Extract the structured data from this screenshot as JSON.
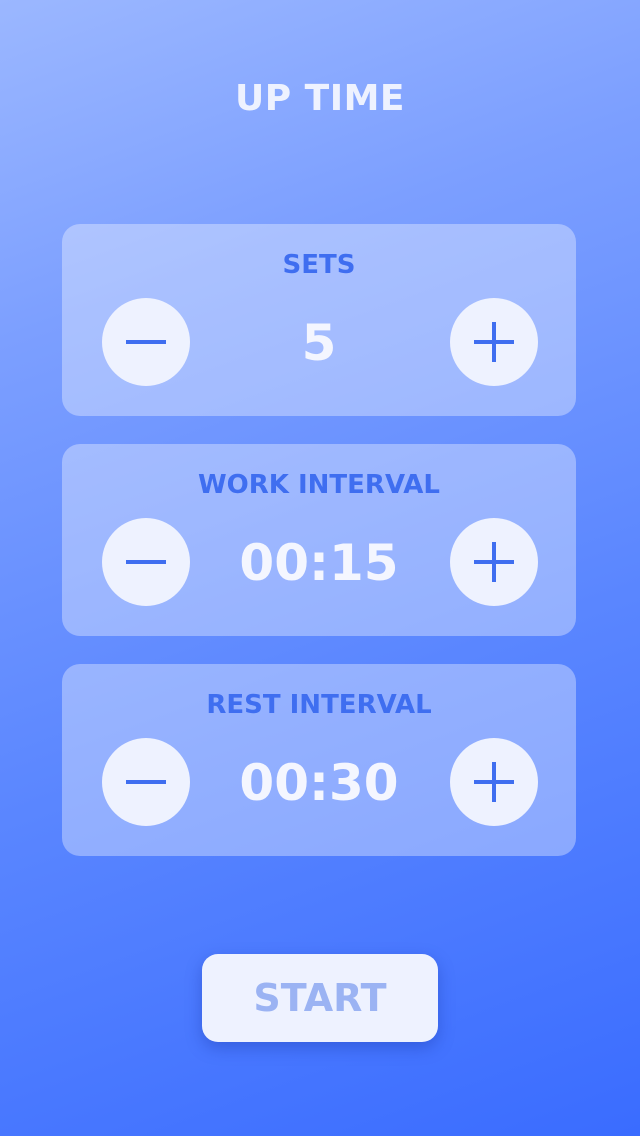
{
  "app": {
    "title": "UP TIME"
  },
  "cards": [
    {
      "label": "SETS",
      "value": "5"
    },
    {
      "label": "WORK INTERVAL",
      "value": "00:15"
    },
    {
      "label": "REST INTERVAL",
      "value": "00:30"
    }
  ],
  "icons": {
    "decrement": "minus-icon",
    "increment": "plus-icon"
  },
  "colors": {
    "accent": "#3f6ef0",
    "button_bg": "#eef2ff",
    "start_text": "#9bb3f3"
  },
  "start": {
    "label": "START"
  }
}
